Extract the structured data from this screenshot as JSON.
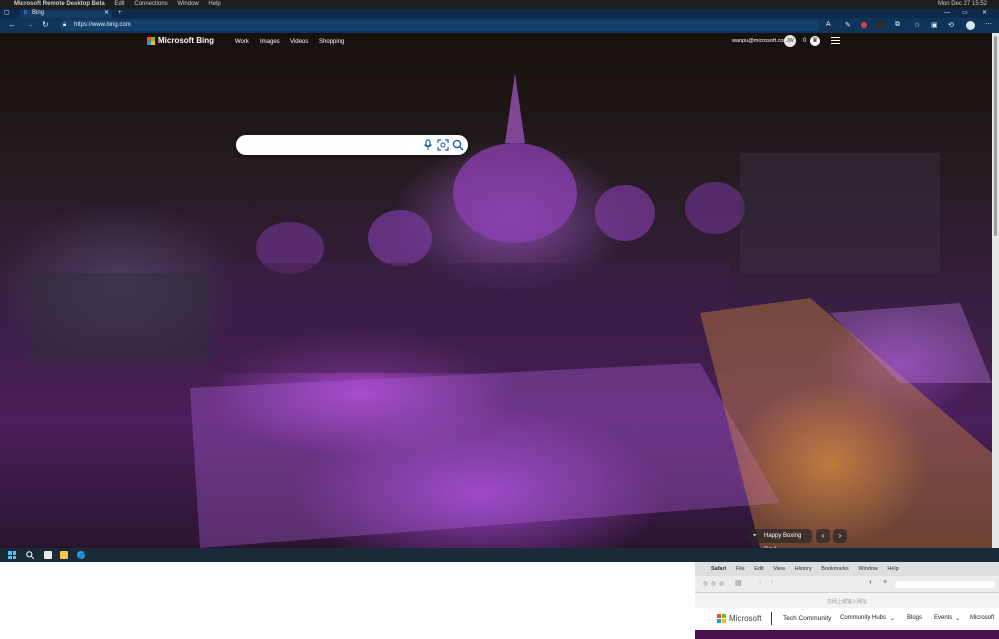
{
  "mac_menubar": {
    "app": "Microsoft Remote Desktop Beta",
    "items": [
      "Edit",
      "Connections",
      "Window",
      "Help"
    ],
    "clock": "Mon Dec 27  15:52"
  },
  "browser": {
    "tab_title": "Bing",
    "url": "https://www.bing.com"
  },
  "bing": {
    "logo_text": "Microsoft Bing",
    "nav": [
      "Work",
      "Images",
      "Videos",
      "Shopping"
    ],
    "account_email": "wanpu@microsoft.com",
    "avatar_initials": "JW",
    "rewards_points": "0",
    "search_placeholder": "",
    "image_caption": "Happy Boxing Day!"
  },
  "safari": {
    "menu": [
      "Safari",
      "File",
      "Edit",
      "View",
      "History",
      "Bookmarks",
      "Window",
      "Help"
    ],
    "hint": "在网上或输入网址",
    "brand": "Microsoft",
    "site": "Tech Community",
    "nav": [
      "Community Hubs",
      "Blogs",
      "Events",
      "Microsoft"
    ]
  },
  "colors": {
    "edge_tabstrip": "#0d2a4a",
    "edge_toolbar": "#0f3359",
    "taskbar": "#1b2a38",
    "ms_red": "#f25022",
    "ms_green": "#7fba00",
    "ms_blue": "#00a4ef",
    "ms_yellow": "#ffb900",
    "purple_accent": "#4b0f4e"
  }
}
